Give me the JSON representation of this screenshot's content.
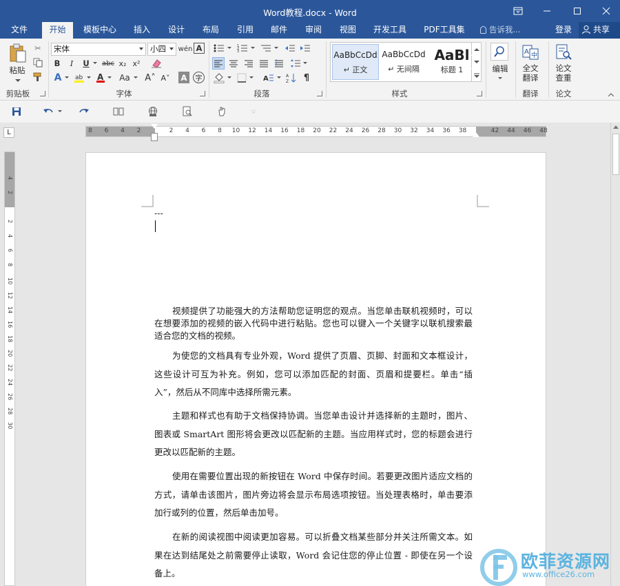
{
  "window": {
    "title": "Word教程.docx - Word"
  },
  "tabs": [
    {
      "label": "文件"
    },
    {
      "label": "开始"
    },
    {
      "label": "模板中心"
    },
    {
      "label": "插入"
    },
    {
      "label": "设计"
    },
    {
      "label": "布局"
    },
    {
      "label": "引用"
    },
    {
      "label": "邮件"
    },
    {
      "label": "审阅"
    },
    {
      "label": "视图"
    },
    {
      "label": "开发工具"
    },
    {
      "label": "PDF工具集"
    }
  ],
  "tell_me": "告诉我...",
  "account": {
    "login": "登录",
    "share": "共享"
  },
  "ribbon": {
    "clipboard": {
      "paste": "粘贴",
      "label": "剪贴板"
    },
    "font": {
      "name": "宋体",
      "size": "小四",
      "label": "字体"
    },
    "paragraph": {
      "label": "段落"
    },
    "styles": {
      "label": "样式",
      "items": [
        {
          "sample": "AaBbCcDd",
          "name": "↵ 正文"
        },
        {
          "sample": "AaBbCcDd",
          "name": "↵ 无间隔"
        },
        {
          "sample": "AaBl",
          "name": "标题 1"
        }
      ]
    },
    "editing": {
      "label": "编辑"
    },
    "translate": {
      "line1": "全文",
      "line2": "翻译",
      "label": "翻译"
    },
    "paper": {
      "line1": "论文",
      "line2": "查重",
      "label": "论文"
    }
  },
  "ruler": {
    "h_ticks": [
      "8",
      "6",
      "4",
      "2",
      "2",
      "4",
      "6",
      "8",
      "10",
      "12",
      "14",
      "16",
      "18",
      "20",
      "22",
      "24",
      "26",
      "28",
      "30",
      "32",
      "34",
      "36",
      "38",
      "42",
      "44",
      "46",
      "48"
    ],
    "v_ticks": [
      "4",
      "2",
      "2",
      "4",
      "6",
      "8",
      "10",
      "12",
      "14",
      "16",
      "18",
      "20",
      "22",
      "24",
      "26",
      "28",
      "30"
    ],
    "corner": "L"
  },
  "document": {
    "first_line": "---",
    "para1": "视频提供了功能强大的方法帮助您证明您的观点。当您单击联机视频时，可以在想要添加的视频的嵌入代码中进行粘贴。您也可以键入一个关键字以联机搜索最适合您的文档的视频。",
    "para2": "为使您的文档具有专业外观，Word 提供了页眉、页脚、封面和文本框设计，这些设计可互为补充。例如，您可以添加匹配的封面、页眉和提要栏。单击“插入”，然后从不同库中选择所需元素。",
    "para3": "主题和样式也有助于文档保持协调。当您单击设计并选择新的主题时，图片、图表或 SmartArt 图形将会更改以匹配新的主题。当应用样式时，您的标题会进行更改以匹配新的主题。",
    "para4": "使用在需要位置出现的新按钮在 Word 中保存时间。若要更改图片适应文档的方式，请单击该图片，图片旁边将会显示布局选项按钮。当处理表格时，单击要添加行或列的位置，然后单击加号。",
    "para5": "在新的阅读视图中阅读更加容易。可以折叠文档某些部分并关注所需文本。如果在达到结尾处之前需要停止读取，Word 会记住您的停止位置 - 即使在另一个设备上。"
  },
  "watermark": {
    "cn": "欧菲资源网",
    "url": "www.office26.com"
  },
  "colors": {
    "brand": "#2b579a",
    "watermark": "#5bb3e0"
  }
}
